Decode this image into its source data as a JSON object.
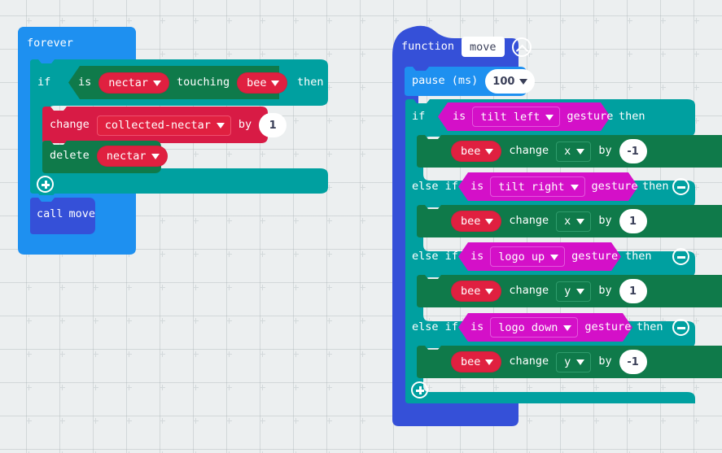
{
  "canvas": {
    "background_color": "#eceff0",
    "grid_dot_color": "#d3d9db"
  },
  "palette": {
    "loop_blue": "#1e90f0",
    "logic_teal": "#00a0a0",
    "sprite_green": "#0f7a4a",
    "variable_red": "#e02040",
    "function_indigo": "#3550d8",
    "input_magenta": "#d410c8",
    "white": "#ffffff",
    "number_text": "#3a3f58"
  },
  "stacks": [
    {
      "id": "forever-stack",
      "label": "forever"
    },
    {
      "id": "function-stack",
      "label": "function"
    }
  ],
  "forever_stack": {
    "header_label": "forever",
    "if_block": {
      "if_label": "if",
      "then_label": "then",
      "condition": {
        "is_label": "is",
        "first_sprite": "nectar",
        "touching_label": "touching",
        "second_sprite": "bee"
      },
      "statements": [
        {
          "type": "change-variable",
          "change_label": "change",
          "variable": "collected-nectar",
          "by_label": "by",
          "value": "1"
        },
        {
          "type": "delete-sprite",
          "delete_label": "delete",
          "sprite": "nectar"
        }
      ],
      "add_branch_icon": "plus-circle-icon"
    },
    "call_block": {
      "call_label": "call",
      "function_name": "move"
    }
  },
  "function_stack": {
    "function_label": "function",
    "function_name": "move",
    "collapse_icon": "chevron-up-circle-icon",
    "pause_block": {
      "label": "pause (ms)",
      "value": "100"
    },
    "if_block": {
      "if_label": "if",
      "else_if_label": "else if",
      "then_label": "then",
      "add_branch_icon": "plus-circle-icon",
      "remove_branch_icon": "minus-circle-icon",
      "branches": [
        {
          "keyword": "if",
          "condition": {
            "is_label": "is",
            "gesture": "tilt left",
            "gesture_label": "gesture"
          },
          "removable": false,
          "statement": {
            "sprite": "bee",
            "change_label": "change",
            "property": "x",
            "by_label": "by",
            "value": "-1"
          }
        },
        {
          "keyword": "else if",
          "condition": {
            "is_label": "is",
            "gesture": "tilt right",
            "gesture_label": "gesture"
          },
          "removable": true,
          "statement": {
            "sprite": "bee",
            "change_label": "change",
            "property": "x",
            "by_label": "by",
            "value": "1"
          }
        },
        {
          "keyword": "else if",
          "condition": {
            "is_label": "is",
            "gesture": "logo up",
            "gesture_label": "gesture"
          },
          "removable": true,
          "statement": {
            "sprite": "bee",
            "change_label": "change",
            "property": "y",
            "by_label": "by",
            "value": "1"
          }
        },
        {
          "keyword": "else if",
          "condition": {
            "is_label": "is",
            "gesture": "logo down",
            "gesture_label": "gesture"
          },
          "removable": true,
          "statement": {
            "sprite": "bee",
            "change_label": "change",
            "property": "y",
            "by_label": "by",
            "value": "-1"
          }
        }
      ]
    }
  }
}
